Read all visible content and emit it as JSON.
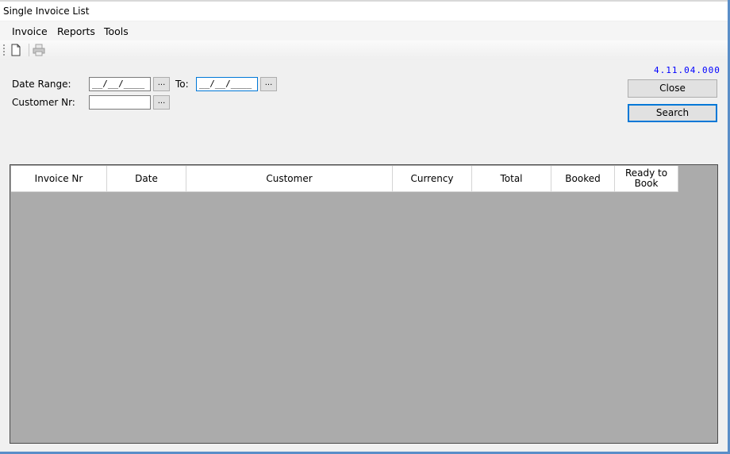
{
  "window": {
    "title": "Single Invoice List"
  },
  "menu": {
    "items": [
      "Invoice",
      "Reports",
      "Tools"
    ]
  },
  "toolbar": {
    "icons": [
      "new-document-icon",
      "print-icon"
    ]
  },
  "filters": {
    "date_range_label": "Date Range:",
    "date_from_value": "__/__/____",
    "to_label": "To:",
    "date_to_value": "__/__/____",
    "customer_label": "Customer Nr:",
    "customer_value": "",
    "picker_label": "..."
  },
  "version": "4.11.04.000",
  "actions": {
    "close_label": "Close",
    "search_label": "Search"
  },
  "grid": {
    "columns": [
      "Invoice Nr",
      "Date",
      "Customer",
      "Currency",
      "Total",
      "Booked",
      "Ready to Book"
    ],
    "rows": []
  },
  "colors": {
    "accent": "#0078d7",
    "grid_background": "#ababab",
    "version_text": "#0000ff"
  }
}
